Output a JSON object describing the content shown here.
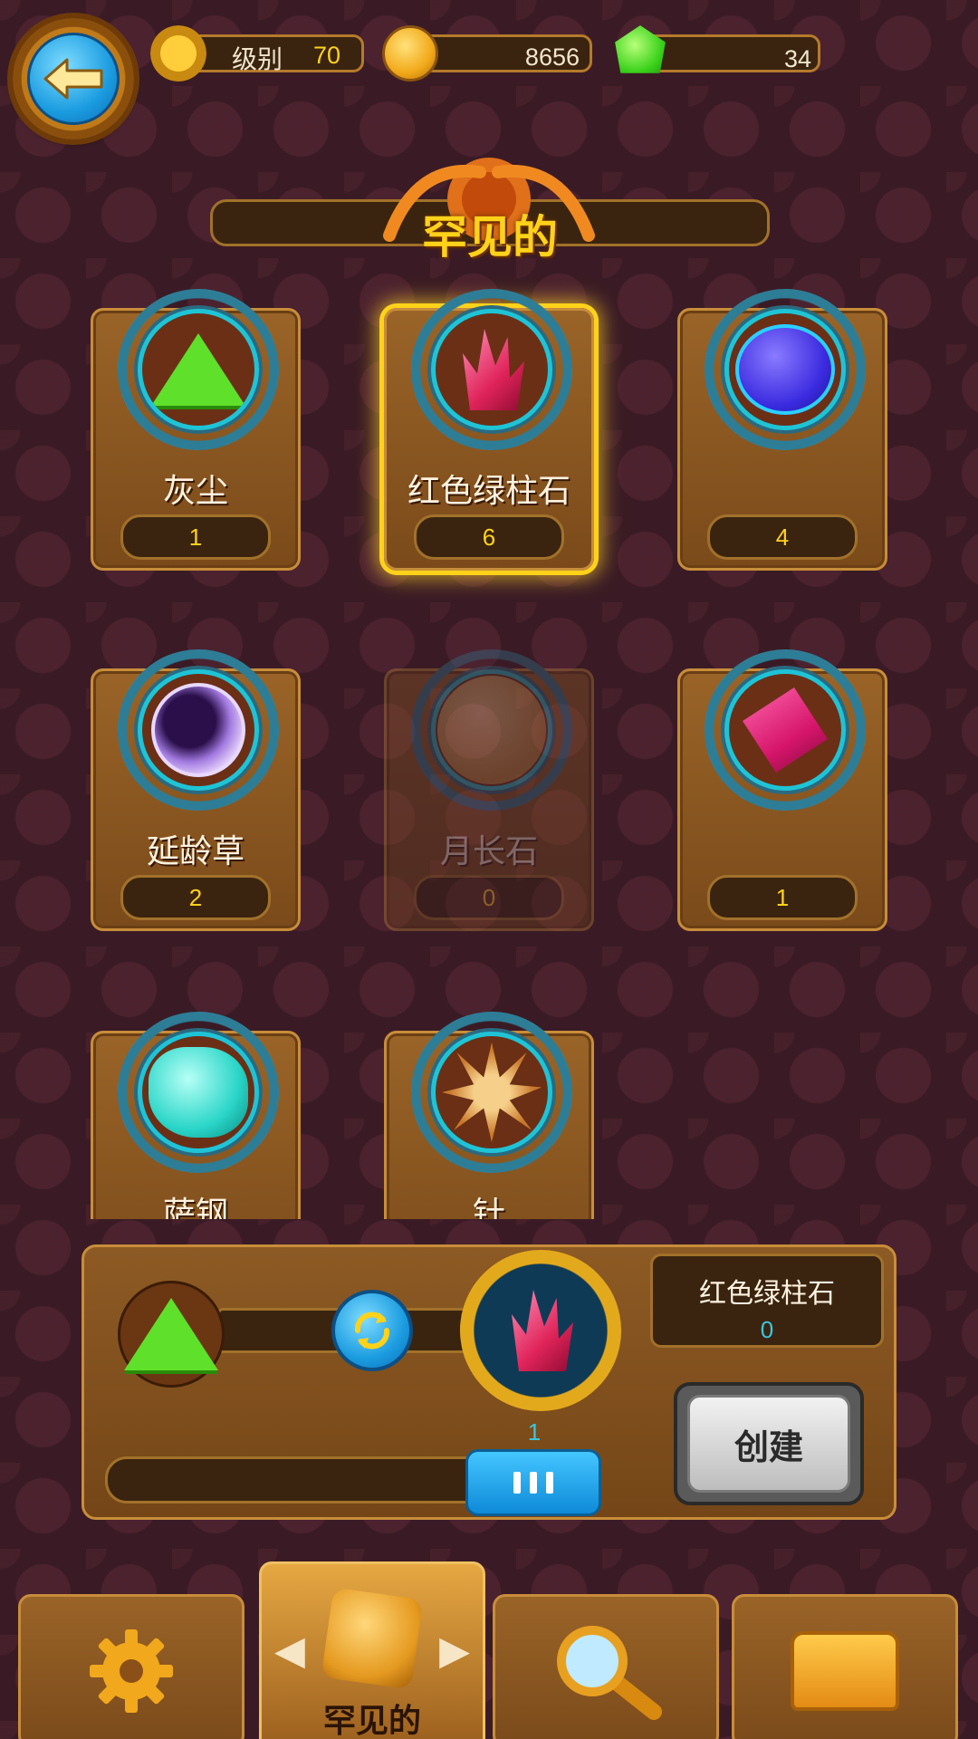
{
  "header": {
    "level_label": "级别",
    "level_value": "70",
    "coins": "8656",
    "gems": "34",
    "back_icon": "back-arrow-icon"
  },
  "section": {
    "title": "罕见的"
  },
  "materials": [
    {
      "name": "灰尘",
      "count": "1",
      "icon": "green-dust-icon",
      "state": "normal"
    },
    {
      "name": "红色绿柱石",
      "count": "6",
      "icon": "red-beryl-crystal-icon",
      "state": "selected"
    },
    {
      "name": "",
      "count": "4",
      "icon": "blue-stone-icon",
      "state": "normal"
    },
    {
      "name": "延龄草",
      "count": "2",
      "icon": "purple-orb-icon",
      "state": "normal"
    },
    {
      "name": "月长石",
      "count": "0",
      "icon": "moonstone-icon",
      "state": "disabled"
    },
    {
      "name": "",
      "count": "1",
      "icon": "pink-gem-icon",
      "state": "normal"
    },
    {
      "name": "萨钢",
      "count": "",
      "icon": "teal-stone-icon",
      "state": "normal"
    },
    {
      "name": "针",
      "count": "",
      "icon": "spiky-needle-icon",
      "state": "normal"
    }
  ],
  "craft": {
    "result_name": "红色绿柱石",
    "result_owned": "0",
    "result_quantity": "1",
    "create_label": "创建"
  },
  "nav": {
    "active_tab_label": "罕见的",
    "tabs": [
      "settings",
      "rare-materials",
      "search",
      "chest"
    ]
  },
  "colors": {
    "accent_gold": "#ffd21a",
    "accent_blue": "#1b9ce0",
    "count_cyan": "#3ac6e0"
  }
}
